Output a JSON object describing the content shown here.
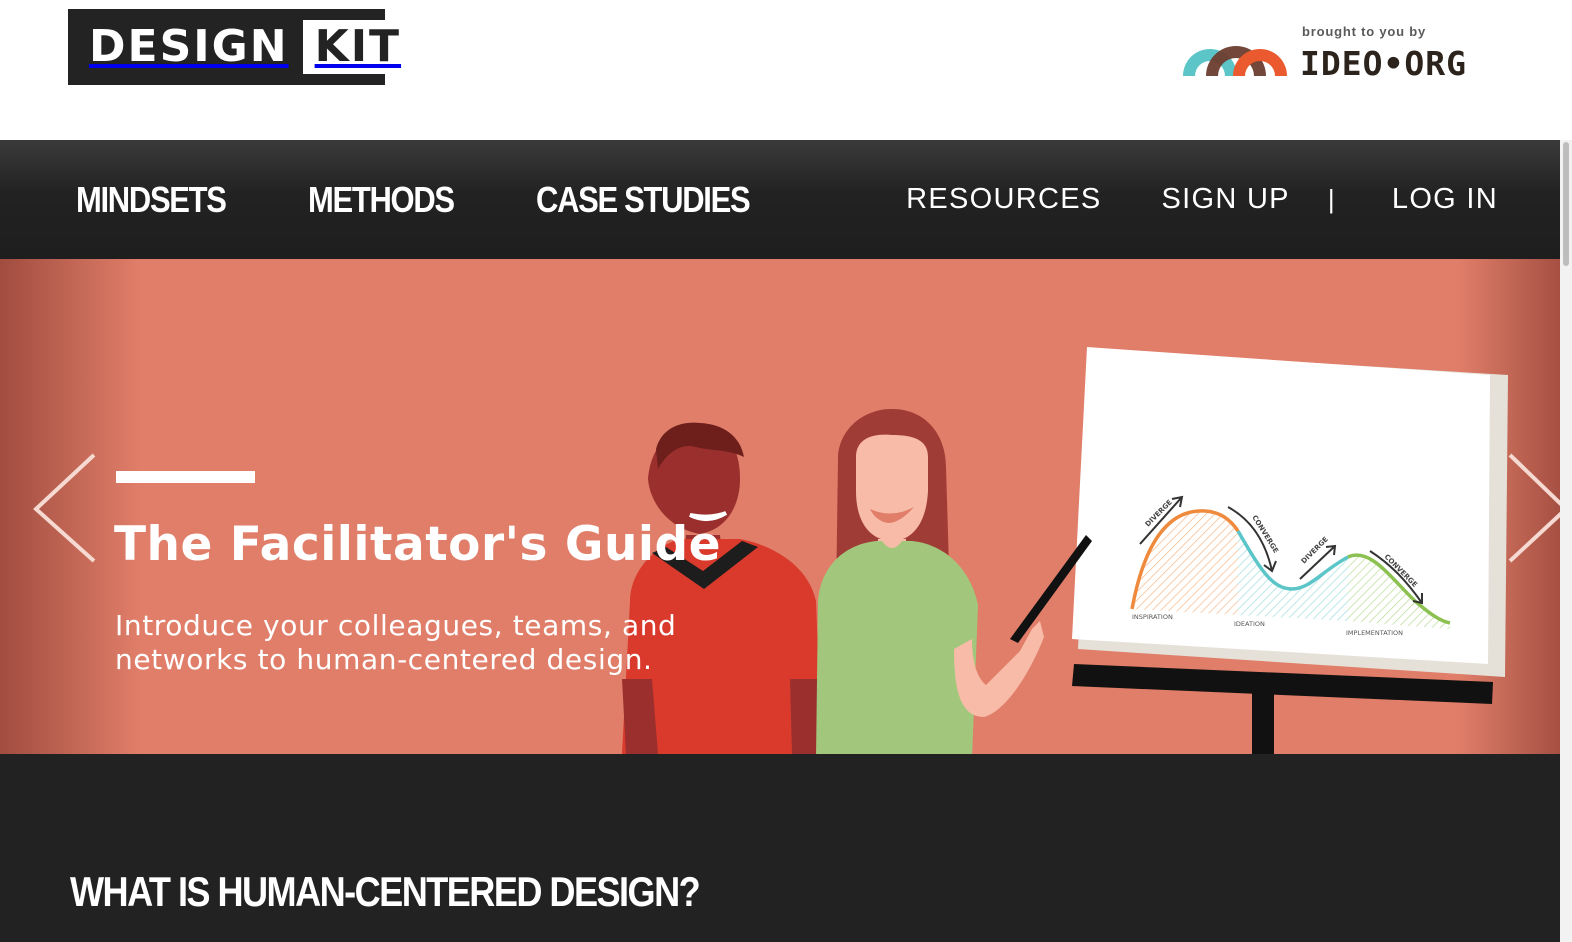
{
  "header": {
    "logo": {
      "word1": "DESIGN",
      "word2": "KIT"
    },
    "partner": {
      "tagline": "brought to you by",
      "name": "IDEO•ORG"
    }
  },
  "nav": {
    "primary": [
      {
        "label": "MINDSETS"
      },
      {
        "label": "METHODS"
      },
      {
        "label": "CASE STUDIES"
      }
    ],
    "secondary": {
      "resources": "RESOURCES",
      "sign_up": "SIGN UP",
      "separator": "|",
      "log_in": "LOG IN"
    }
  },
  "hero": {
    "title": "The Facilitator's Guide",
    "description": "Introduce your colleagues, teams, and networks to human-centered design.",
    "background_color": "#e07e69",
    "diagram": {
      "labels": {
        "diverge1": "DIVERGE",
        "converge1": "CONVERGE",
        "diverge2": "DIVERGE",
        "converge2": "CONVERGE"
      },
      "phases": [
        "INSPIRATION",
        "IDEATION",
        "IMPLEMENTATION"
      ],
      "colors": {
        "inspiration": "#ef8a3c",
        "ideation": "#5cc5c8",
        "implementation": "#8cc152"
      }
    },
    "prev_icon": "chevron-left-icon",
    "next_icon": "chevron-right-icon"
  },
  "intro": {
    "heading": "WHAT IS HUMAN-CENTERED DESIGN?"
  },
  "colors": {
    "nav_bg": "#222222",
    "section_bg": "#222222",
    "ideo_teal": "#5cc5c8",
    "ideo_orange": "#ea5a2e"
  }
}
